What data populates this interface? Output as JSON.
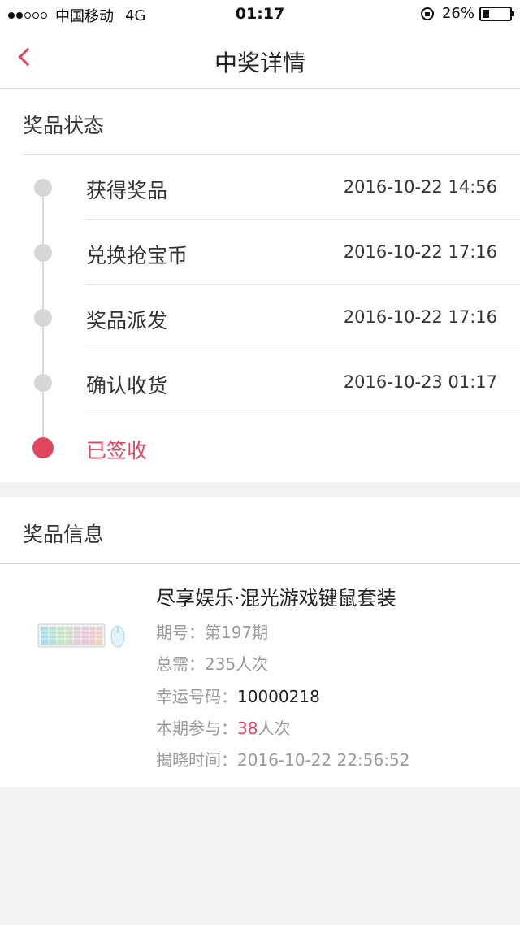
{
  "status_bar": {
    "carrier": "中国移动",
    "network": "4G",
    "time": "01:17",
    "battery": "26%"
  },
  "nav": {
    "title": "中奖详情"
  },
  "prize_status": {
    "header": "奖品状态",
    "steps": [
      {
        "label": "获得奖品",
        "time": "2016-10-22 14:56"
      },
      {
        "label": "兑换抢宝币",
        "time": "2016-10-22 17:16"
      },
      {
        "label": "奖品派发",
        "time": "2016-10-22 17:16"
      },
      {
        "label": "确认收货",
        "time": "2016-10-23 01:17"
      },
      {
        "label": "已签收",
        "time": ""
      }
    ]
  },
  "prize_info": {
    "header": "奖品信息",
    "title": "尽享娱乐·混光游戏键鼠套装",
    "issue_label": "期号：",
    "issue_value": "第197期",
    "total_label": "总需：",
    "total_value": "235人次",
    "lucky_label": "幸运号码：",
    "lucky_value": "10000218",
    "join_label": "本期参与：",
    "join_count": "38",
    "join_unit": "人次",
    "reveal_label": "揭晓时间：",
    "reveal_value": "2016-10-22 22:56:52"
  },
  "colors": {
    "accent": "#e0465e",
    "inactive_dot": "#d6d6d6",
    "background": "#f2f2f2"
  }
}
